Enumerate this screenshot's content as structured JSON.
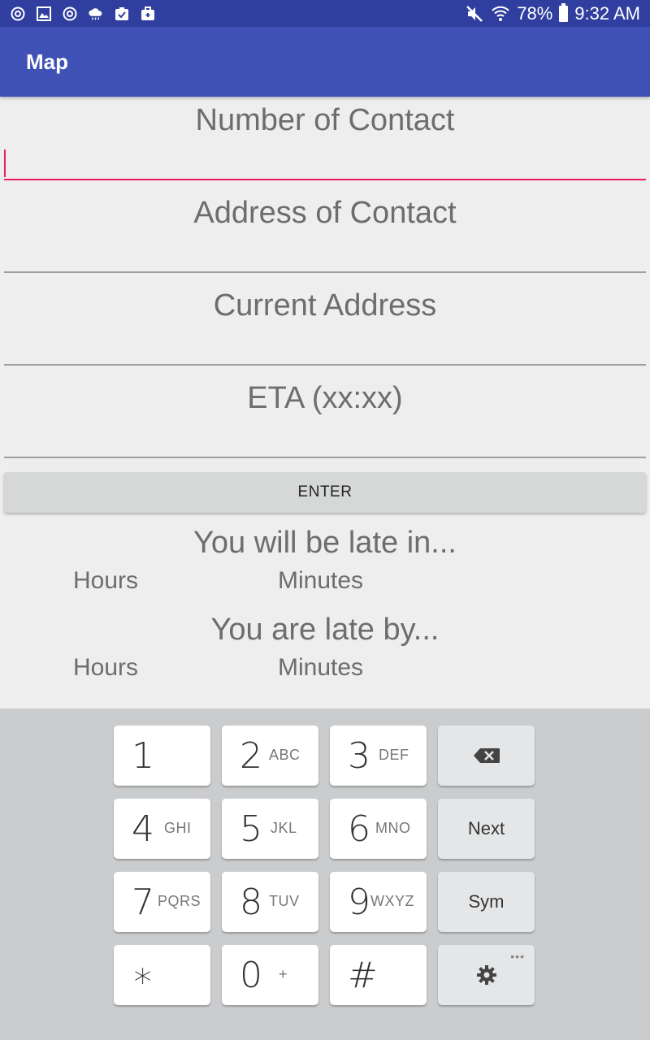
{
  "status_bar": {
    "battery": "78%",
    "time": "9:32 AM"
  },
  "app_bar": {
    "title": "Map"
  },
  "form": {
    "fields": [
      {
        "label": "Number of Contact",
        "value": ""
      },
      {
        "label": "Address of Contact",
        "value": ""
      },
      {
        "label": "Current Address",
        "value": ""
      },
      {
        "label": "ETA (xx:xx)",
        "value": ""
      }
    ],
    "enter_label": "ENTER"
  },
  "results": {
    "late_in": {
      "title": "You will be late in...",
      "hours_label": "Hours",
      "minutes_label": "Minutes"
    },
    "late_by": {
      "title": "You are late by...",
      "hours_label": "Hours",
      "minutes_label": "Minutes"
    }
  },
  "keyboard": {
    "keys": [
      {
        "num": "1",
        "sub": ""
      },
      {
        "num": "2",
        "sub": "ABC"
      },
      {
        "num": "3",
        "sub": "DEF"
      },
      {
        "num": "4",
        "sub": "GHI"
      },
      {
        "num": "5",
        "sub": "JKL"
      },
      {
        "num": "6",
        "sub": "MNO"
      },
      {
        "num": "7",
        "sub": "PQRS"
      },
      {
        "num": "8",
        "sub": "TUV"
      },
      {
        "num": "9",
        "sub": "WXYZ"
      },
      {
        "num": "∗",
        "sub": ""
      },
      {
        "num": "0",
        "sub": "+"
      },
      {
        "num": "#",
        "sub": ""
      }
    ],
    "next_label": "Next",
    "sym_label": "Sym",
    "more_dots": "•••"
  },
  "colors": {
    "status_bar": "#303f9f",
    "app_bar": "#3f51b5",
    "accent": "#e91e63"
  }
}
